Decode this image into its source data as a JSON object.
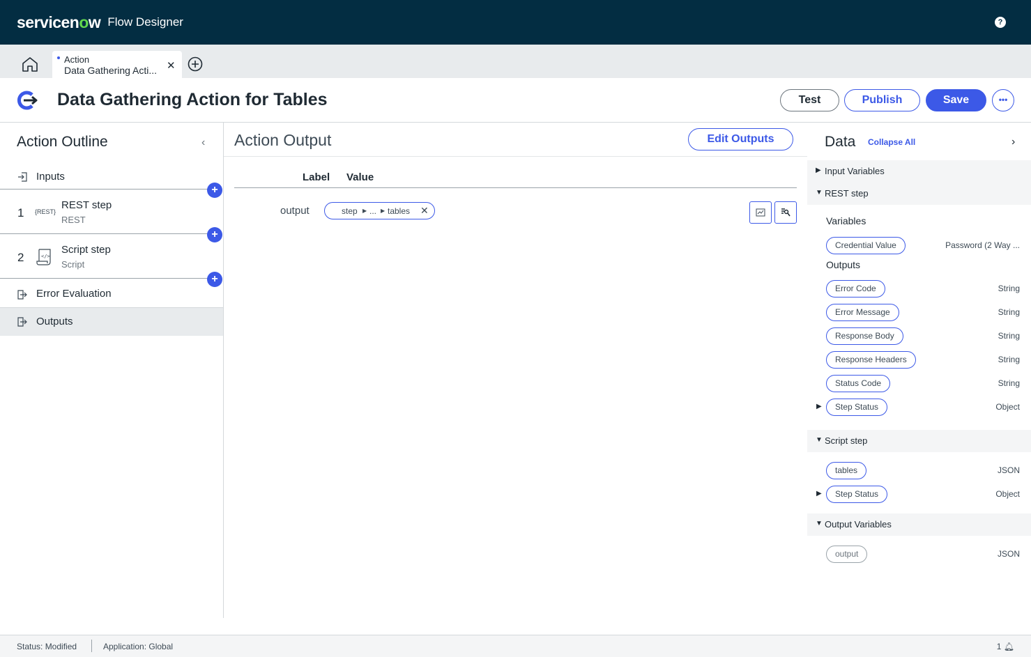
{
  "topbar": {
    "logo": "servicenow",
    "app_title": "Flow Designer",
    "help": "?"
  },
  "tabs": {
    "active": {
      "type": "Action",
      "name": "Data Gathering Acti..."
    }
  },
  "header": {
    "title": "Data Gathering Action for Tables",
    "test": "Test",
    "publish": "Publish",
    "save": "Save",
    "more": "•••"
  },
  "outline": {
    "title": "Action Outline",
    "inputs": "Inputs",
    "steps": [
      {
        "num": "1",
        "icon_text": "{REST}",
        "label": "REST step",
        "sub": "REST"
      },
      {
        "num": "2",
        "label": "Script step",
        "sub": "Script"
      }
    ],
    "error_evaluation": "Error Evaluation",
    "outputs": "Outputs"
  },
  "output_panel": {
    "title": "Action Output",
    "edit_button": "Edit Outputs",
    "col_label": "Label",
    "col_value": "Value",
    "row_label": "output",
    "pill": {
      "part1": "step",
      "part2": "...",
      "part3": "tables"
    }
  },
  "data_panel": {
    "title": "Data",
    "collapse_all": "Collapse All",
    "input_variables": "Input Variables",
    "rest_step": "REST step",
    "variables_head": "Variables",
    "credential": {
      "label": "Credential Value",
      "type": "Password (2 Way ..."
    },
    "outputs_head": "Outputs",
    "rest_outputs": [
      {
        "label": "Error Code",
        "type": "String"
      },
      {
        "label": "Error Message",
        "type": "String"
      },
      {
        "label": "Response Body",
        "type": "String"
      },
      {
        "label": "Response Headers",
        "type": "String"
      },
      {
        "label": "Status Code",
        "type": "String"
      },
      {
        "label": "Step Status",
        "type": "Object"
      }
    ],
    "script_step": "Script step",
    "script_outputs": [
      {
        "label": "tables",
        "type": "JSON"
      },
      {
        "label": "Step Status",
        "type": "Object"
      }
    ],
    "output_variables": "Output Variables",
    "output_var": {
      "label": "output",
      "type": "JSON"
    }
  },
  "status": {
    "status": "Status: Modified",
    "application": "Application: Global",
    "notifications": "1"
  }
}
